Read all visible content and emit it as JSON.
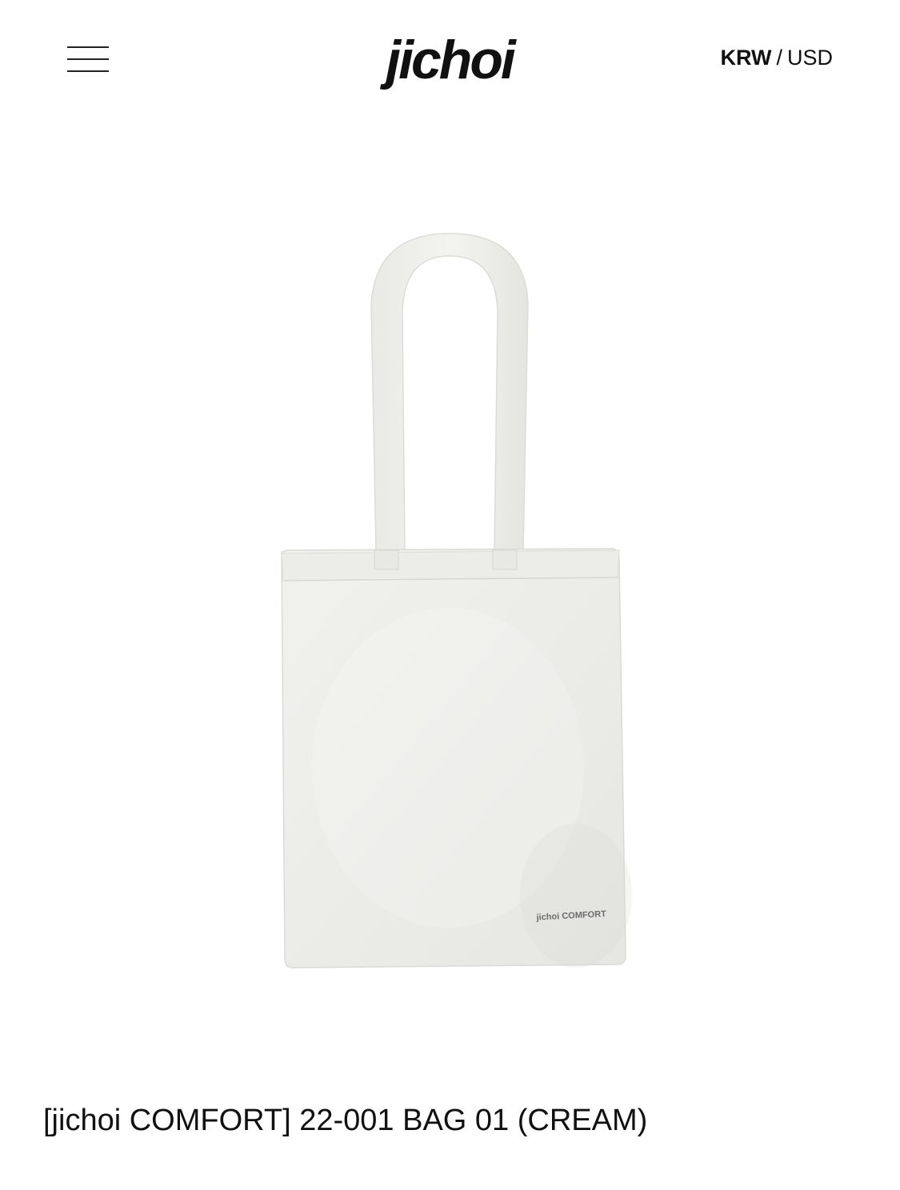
{
  "header": {
    "menu_icon": "hamburger-menu-icon",
    "logo": "jichoi",
    "currency": {
      "active": "KRW",
      "separator": "/",
      "other": "USD"
    }
  },
  "product": {
    "image_label": "jichoi COMFORT",
    "title": "[jichoi COMFORT] 22-001 BAG 01 (CREAM)",
    "colors": {
      "bag": "#eeeeeb",
      "bag_shadow": "#dcdcd8"
    }
  }
}
